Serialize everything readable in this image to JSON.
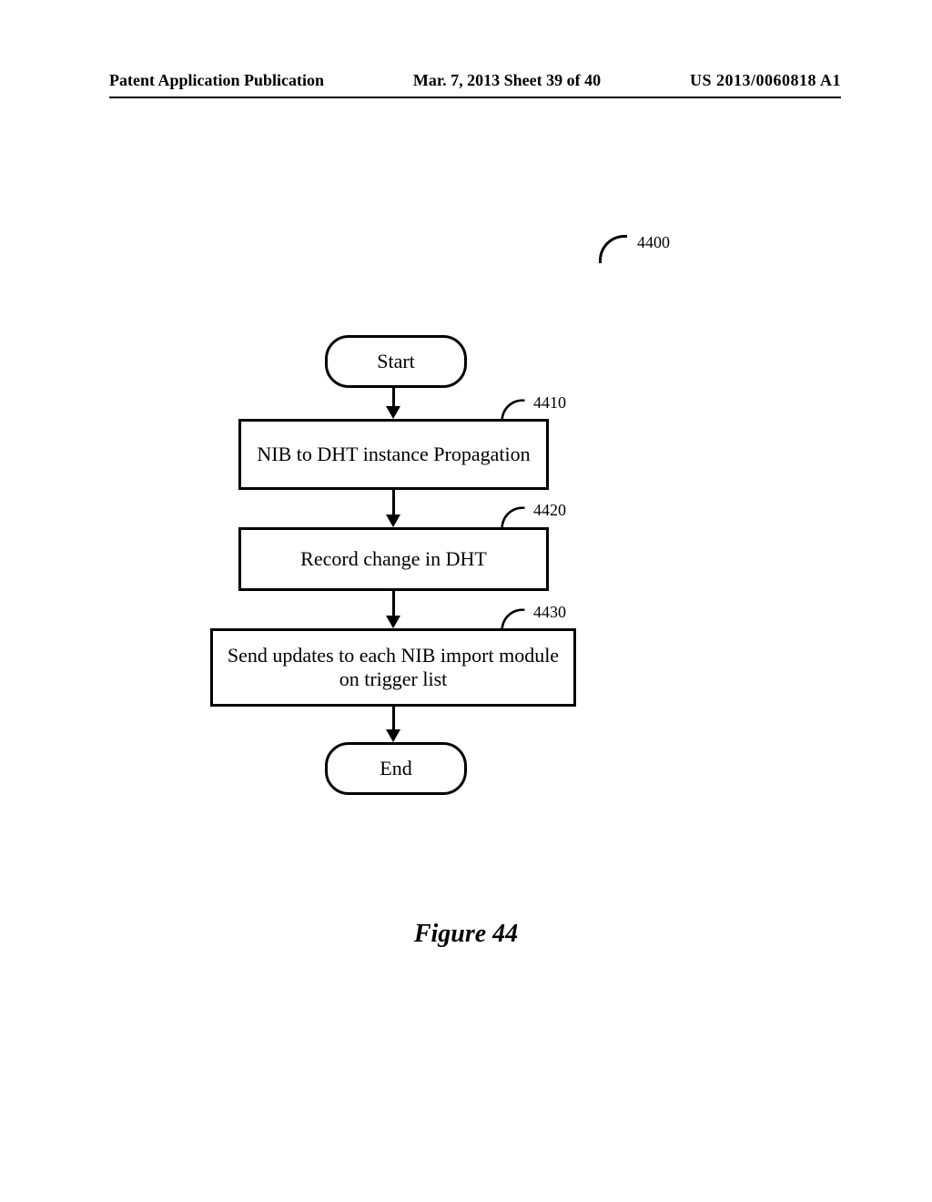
{
  "header": {
    "left": "Patent Application Publication",
    "center": "Mar. 7, 2013  Sheet 39 of 40",
    "right": "US 2013/0060818 A1"
  },
  "refs": {
    "figure": "4400",
    "step1": "4410",
    "step2": "4420",
    "step3": "4430"
  },
  "nodes": {
    "start": "Start",
    "step1": "NIB to DHT instance Propagation",
    "step2": "Record change in DHT",
    "step3": "Send updates to each NIB import module on trigger list",
    "end": "End"
  },
  "caption": "Figure 44"
}
